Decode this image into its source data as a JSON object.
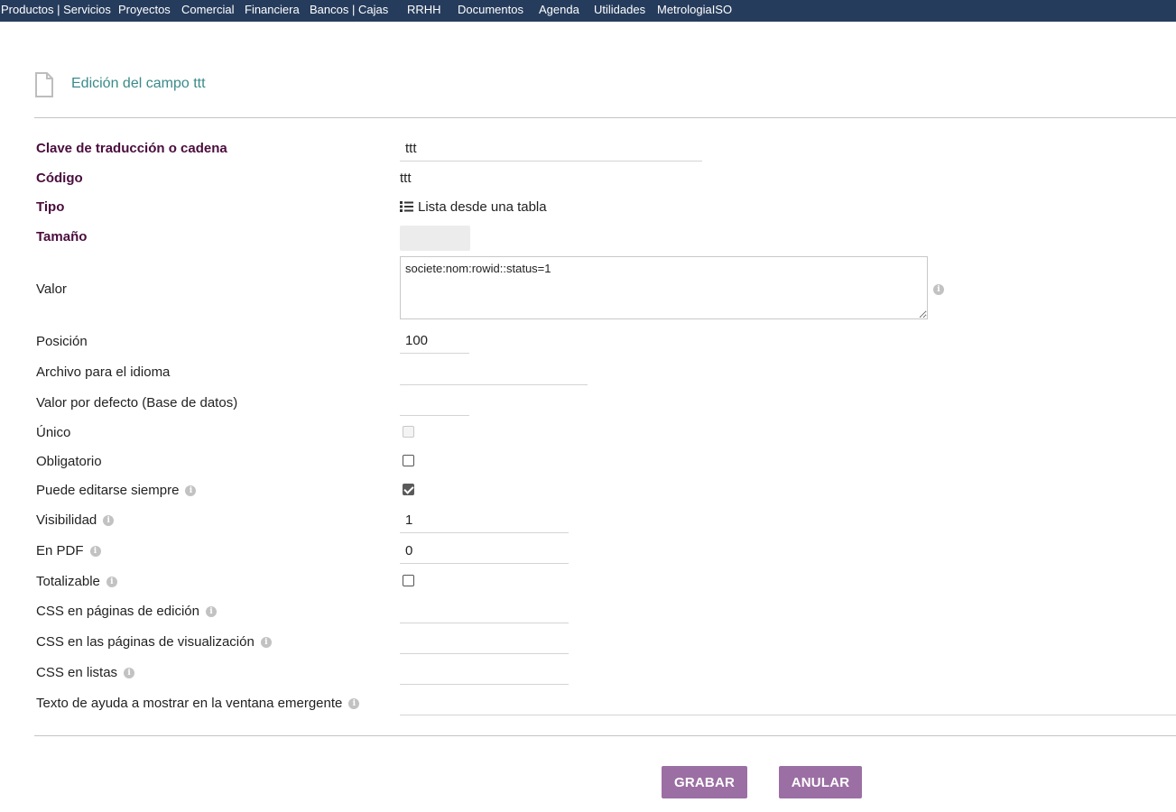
{
  "nav": {
    "items": [
      "Productos | Servicios",
      "Proyectos",
      "Comercial",
      "Financiera",
      "Bancos | Cajas",
      "RRHH",
      "Documentos",
      "Agenda",
      "Utilidades",
      "MetrologiaISO"
    ]
  },
  "header": {
    "icon": "document-icon",
    "title": "Edición del campo ttt"
  },
  "form": {
    "clave": {
      "label": "Clave de traducción o cadena",
      "value": "ttt"
    },
    "codigo": {
      "label": "Código",
      "value": "ttt"
    },
    "tipo": {
      "label": "Tipo",
      "value": "Lista desde una tabla",
      "icon": "list-icon"
    },
    "tamano": {
      "label": "Tamaño",
      "value": ""
    },
    "valor": {
      "label": "Valor",
      "value": "societe:nom:rowid::status=1"
    },
    "posicion": {
      "label": "Posición",
      "value": "100"
    },
    "archivo": {
      "label": "Archivo para el idioma",
      "value": ""
    },
    "valor_defecto": {
      "label": "Valor por defecto (Base de datos)",
      "value": ""
    },
    "unico": {
      "label": "Único",
      "checked": false,
      "disabled": true
    },
    "obligatorio": {
      "label": "Obligatorio",
      "checked": false
    },
    "editable": {
      "label": "Puede editarse siempre",
      "checked": true
    },
    "visibilidad": {
      "label": "Visibilidad",
      "value": "1"
    },
    "en_pdf": {
      "label": "En PDF",
      "value": "0"
    },
    "totalizable": {
      "label": "Totalizable",
      "checked": false
    },
    "css_edicion": {
      "label": "CSS en páginas de edición",
      "value": ""
    },
    "css_visualizacion": {
      "label": "CSS en las páginas de visualización",
      "value": ""
    },
    "css_listas": {
      "label": "CSS en listas",
      "value": ""
    },
    "ayuda": {
      "label": "Texto de ayuda a mostrar en la ventana emergente",
      "value": ""
    }
  },
  "buttons": {
    "save": "GRABAR",
    "cancel": "ANULAR"
  },
  "colors": {
    "nav_bg": "#263c5c",
    "title": "#3a8a8a",
    "required_label": "#4a0d3d",
    "button": "#9b6fa3"
  }
}
